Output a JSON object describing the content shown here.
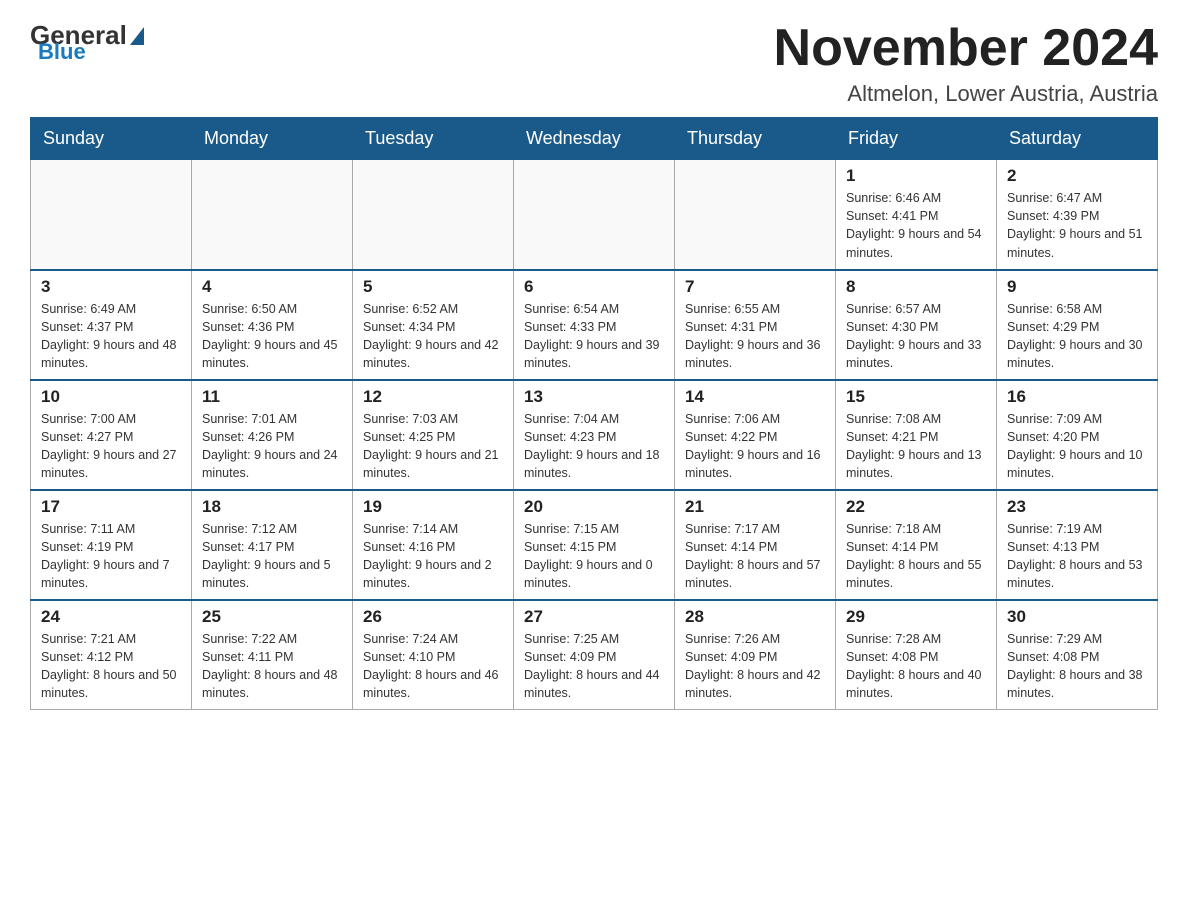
{
  "logo": {
    "general": "General",
    "blue": "Blue"
  },
  "title": "November 2024",
  "location": "Altmelon, Lower Austria, Austria",
  "days_of_week": [
    "Sunday",
    "Monday",
    "Tuesday",
    "Wednesday",
    "Thursday",
    "Friday",
    "Saturday"
  ],
  "weeks": [
    [
      {
        "day": "",
        "info": ""
      },
      {
        "day": "",
        "info": ""
      },
      {
        "day": "",
        "info": ""
      },
      {
        "day": "",
        "info": ""
      },
      {
        "day": "",
        "info": ""
      },
      {
        "day": "1",
        "info": "Sunrise: 6:46 AM\nSunset: 4:41 PM\nDaylight: 9 hours and 54 minutes."
      },
      {
        "day": "2",
        "info": "Sunrise: 6:47 AM\nSunset: 4:39 PM\nDaylight: 9 hours and 51 minutes."
      }
    ],
    [
      {
        "day": "3",
        "info": "Sunrise: 6:49 AM\nSunset: 4:37 PM\nDaylight: 9 hours and 48 minutes."
      },
      {
        "day": "4",
        "info": "Sunrise: 6:50 AM\nSunset: 4:36 PM\nDaylight: 9 hours and 45 minutes."
      },
      {
        "day": "5",
        "info": "Sunrise: 6:52 AM\nSunset: 4:34 PM\nDaylight: 9 hours and 42 minutes."
      },
      {
        "day": "6",
        "info": "Sunrise: 6:54 AM\nSunset: 4:33 PM\nDaylight: 9 hours and 39 minutes."
      },
      {
        "day": "7",
        "info": "Sunrise: 6:55 AM\nSunset: 4:31 PM\nDaylight: 9 hours and 36 minutes."
      },
      {
        "day": "8",
        "info": "Sunrise: 6:57 AM\nSunset: 4:30 PM\nDaylight: 9 hours and 33 minutes."
      },
      {
        "day": "9",
        "info": "Sunrise: 6:58 AM\nSunset: 4:29 PM\nDaylight: 9 hours and 30 minutes."
      }
    ],
    [
      {
        "day": "10",
        "info": "Sunrise: 7:00 AM\nSunset: 4:27 PM\nDaylight: 9 hours and 27 minutes."
      },
      {
        "day": "11",
        "info": "Sunrise: 7:01 AM\nSunset: 4:26 PM\nDaylight: 9 hours and 24 minutes."
      },
      {
        "day": "12",
        "info": "Sunrise: 7:03 AM\nSunset: 4:25 PM\nDaylight: 9 hours and 21 minutes."
      },
      {
        "day": "13",
        "info": "Sunrise: 7:04 AM\nSunset: 4:23 PM\nDaylight: 9 hours and 18 minutes."
      },
      {
        "day": "14",
        "info": "Sunrise: 7:06 AM\nSunset: 4:22 PM\nDaylight: 9 hours and 16 minutes."
      },
      {
        "day": "15",
        "info": "Sunrise: 7:08 AM\nSunset: 4:21 PM\nDaylight: 9 hours and 13 minutes."
      },
      {
        "day": "16",
        "info": "Sunrise: 7:09 AM\nSunset: 4:20 PM\nDaylight: 9 hours and 10 minutes."
      }
    ],
    [
      {
        "day": "17",
        "info": "Sunrise: 7:11 AM\nSunset: 4:19 PM\nDaylight: 9 hours and 7 minutes."
      },
      {
        "day": "18",
        "info": "Sunrise: 7:12 AM\nSunset: 4:17 PM\nDaylight: 9 hours and 5 minutes."
      },
      {
        "day": "19",
        "info": "Sunrise: 7:14 AM\nSunset: 4:16 PM\nDaylight: 9 hours and 2 minutes."
      },
      {
        "day": "20",
        "info": "Sunrise: 7:15 AM\nSunset: 4:15 PM\nDaylight: 9 hours and 0 minutes."
      },
      {
        "day": "21",
        "info": "Sunrise: 7:17 AM\nSunset: 4:14 PM\nDaylight: 8 hours and 57 minutes."
      },
      {
        "day": "22",
        "info": "Sunrise: 7:18 AM\nSunset: 4:14 PM\nDaylight: 8 hours and 55 minutes."
      },
      {
        "day": "23",
        "info": "Sunrise: 7:19 AM\nSunset: 4:13 PM\nDaylight: 8 hours and 53 minutes."
      }
    ],
    [
      {
        "day": "24",
        "info": "Sunrise: 7:21 AM\nSunset: 4:12 PM\nDaylight: 8 hours and 50 minutes."
      },
      {
        "day": "25",
        "info": "Sunrise: 7:22 AM\nSunset: 4:11 PM\nDaylight: 8 hours and 48 minutes."
      },
      {
        "day": "26",
        "info": "Sunrise: 7:24 AM\nSunset: 4:10 PM\nDaylight: 8 hours and 46 minutes."
      },
      {
        "day": "27",
        "info": "Sunrise: 7:25 AM\nSunset: 4:09 PM\nDaylight: 8 hours and 44 minutes."
      },
      {
        "day": "28",
        "info": "Sunrise: 7:26 AM\nSunset: 4:09 PM\nDaylight: 8 hours and 42 minutes."
      },
      {
        "day": "29",
        "info": "Sunrise: 7:28 AM\nSunset: 4:08 PM\nDaylight: 8 hours and 40 minutes."
      },
      {
        "day": "30",
        "info": "Sunrise: 7:29 AM\nSunset: 4:08 PM\nDaylight: 8 hours and 38 minutes."
      }
    ]
  ]
}
